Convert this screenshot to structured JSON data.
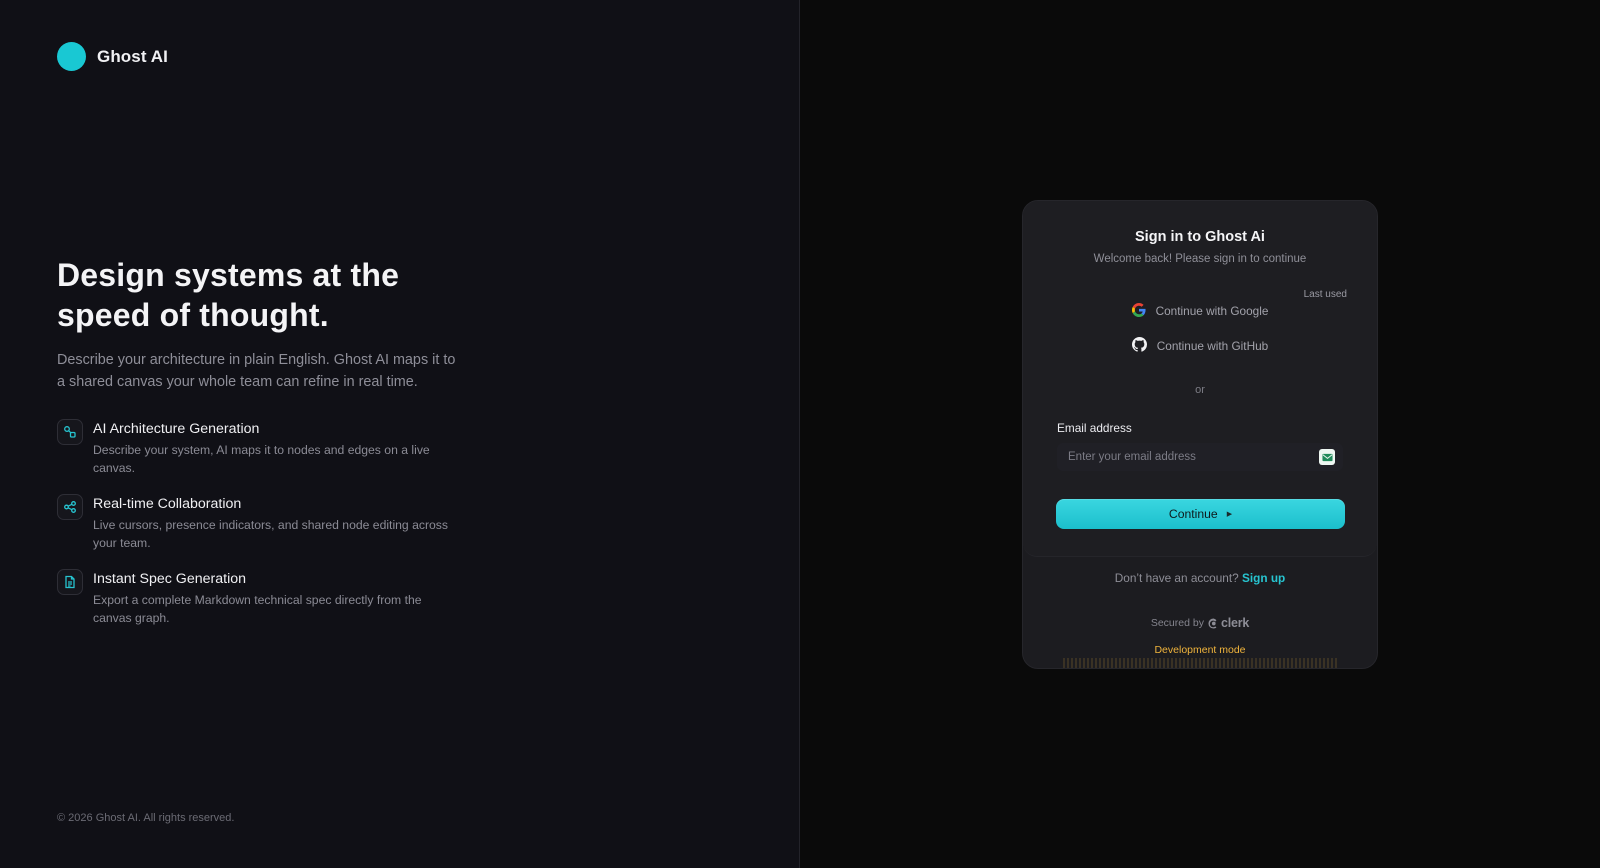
{
  "brand": {
    "name": "Ghost AI",
    "color": "#19c8d3"
  },
  "hero": {
    "headline": "Design systems at the speed of thought.",
    "description": "Describe your architecture in plain English. Ghost AI maps it to a shared canvas your whole team can refine in real time."
  },
  "features": [
    {
      "icon": "nodes-icon",
      "title": "AI Architecture Generation",
      "description": "Describe your system, AI maps it to nodes and edges on a live canvas."
    },
    {
      "icon": "share-icon",
      "title": "Real-time Collaboration",
      "description": "Live cursors, presence indicators, and shared node editing across your team."
    },
    {
      "icon": "document-icon",
      "title": "Instant Spec Generation",
      "description": "Export a complete Markdown technical spec directly from the canvas graph."
    }
  ],
  "footer": {
    "copyright": "© 2026 Ghost AI. All rights reserved."
  },
  "signin": {
    "title": "Sign in to Ghost Ai",
    "subtitle": "Welcome back! Please sign in to continue",
    "last_used": "Last used",
    "google_label": "Continue with Google",
    "github_label": "Continue with GitHub",
    "or_label": "or",
    "email_label": "Email address",
    "email_placeholder": "Enter your email address",
    "email_value": "",
    "continue_label": "Continue",
    "no_account_text": "Don’t have an account?",
    "signup_label": "Sign up",
    "secured_by": "Secured by",
    "clerk_name": "clerk",
    "dev_mode": "Development mode"
  },
  "colors": {
    "accent": "#19c8d3",
    "warning": "#f0b43c"
  }
}
